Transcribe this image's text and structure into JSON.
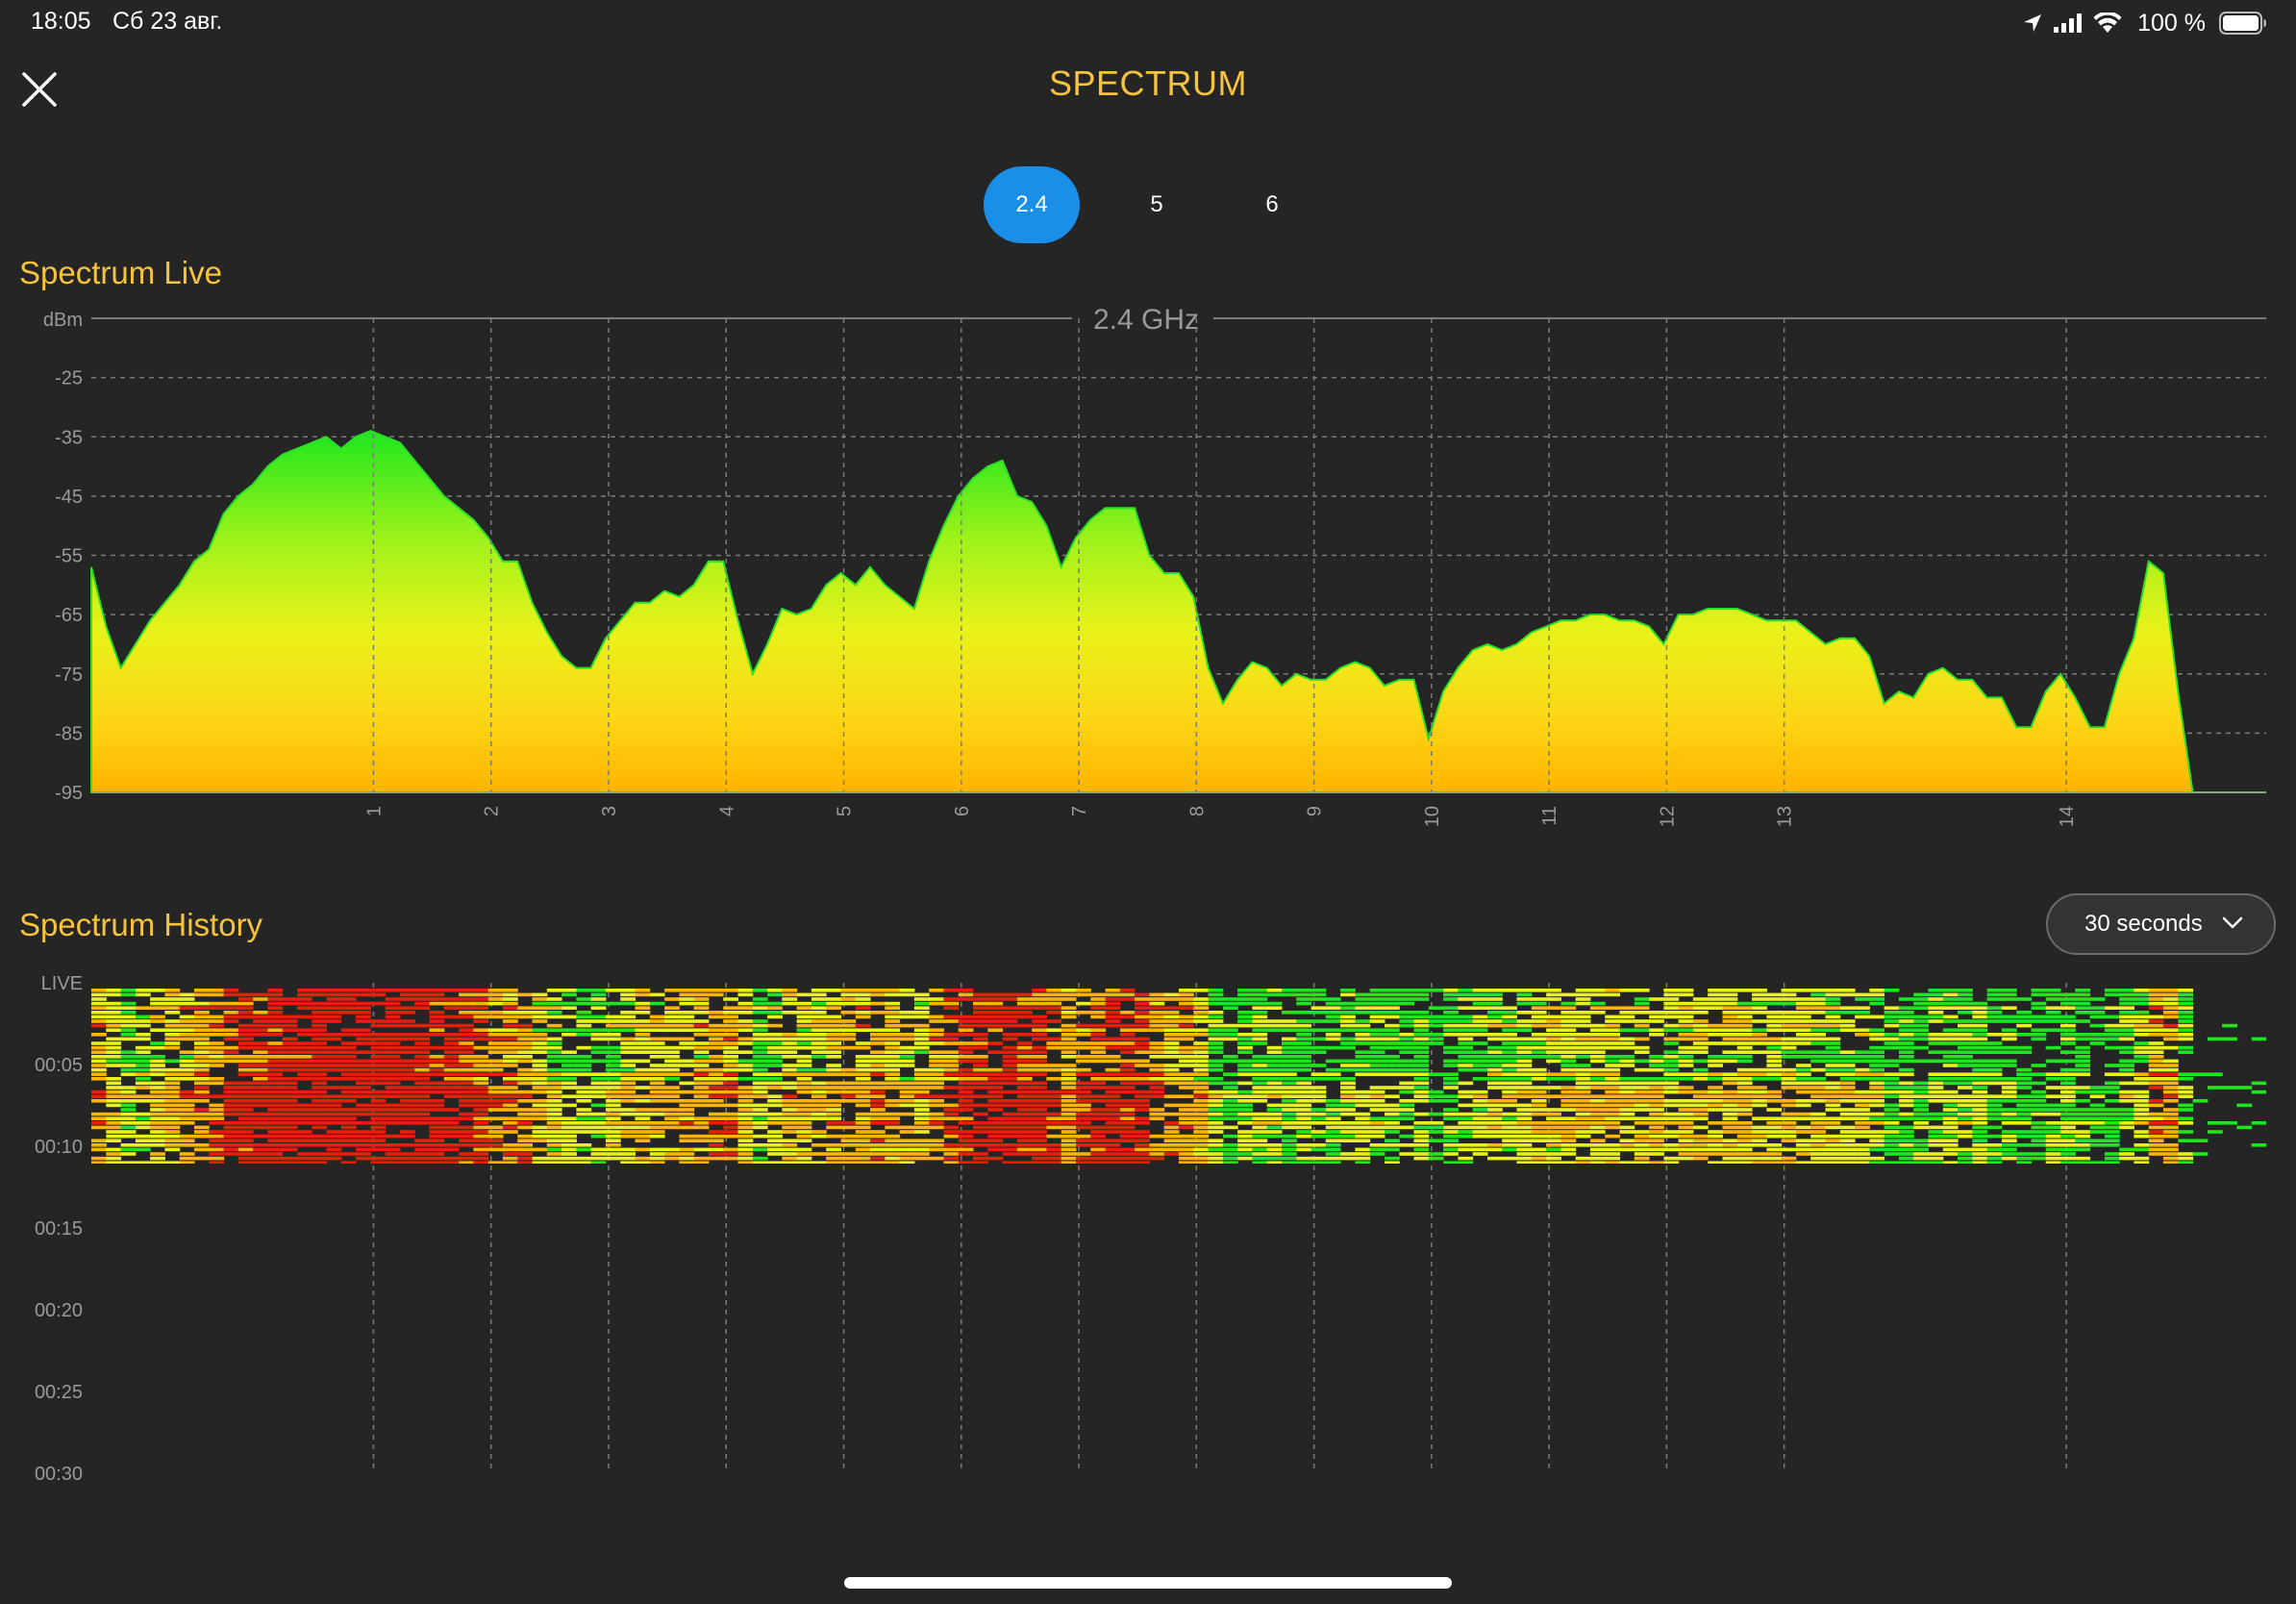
{
  "status_bar": {
    "time": "18:05",
    "date": "Сб 23 авг.",
    "battery": "100 %"
  },
  "header": {
    "title": "SPECTRUM",
    "close_icon": "close-icon"
  },
  "band_tabs": [
    {
      "label": "2.4",
      "active": true
    },
    {
      "label": "5",
      "active": false
    },
    {
      "label": "6",
      "active": false
    }
  ],
  "live": {
    "title": "Spectrum Live",
    "band_label": "2.4 GHz"
  },
  "history": {
    "title": "Spectrum History",
    "range_selected": "30 seconds"
  },
  "colors": {
    "accent": "#f7c33c",
    "active_tab": "#1a8fe8",
    "background": "#252525",
    "grid": "#7a7a7a",
    "signal_green": "#1ee61e",
    "signal_yellow": "#e8f21a",
    "signal_orange": "#ffb400",
    "signal_red": "#e81e0a"
  },
  "chart_data": [
    {
      "type": "area",
      "ylabel": "dBm",
      "ylim": [
        -95,
        -15
      ],
      "y_ticks": [
        -25,
        -35,
        -45,
        -55,
        -65,
        -75,
        -85,
        -95
      ],
      "x_ticks": [
        "1",
        "2",
        "3",
        "4",
        "5",
        "6",
        "7",
        "8",
        "9",
        "10",
        "11",
        "12",
        "13",
        "14"
      ],
      "grid": true,
      "x": [
        0,
        0.25,
        0.5,
        0.75,
        1,
        1.25,
        1.5,
        1.75,
        2,
        2.25,
        2.5,
        2.75,
        3,
        3.25,
        3.5,
        3.75,
        4,
        4.25,
        4.5,
        4.75,
        5,
        5.25,
        5.5,
        5.75,
        6,
        6.25,
        6.5,
        6.75,
        7,
        7.25,
        7.5,
        7.75,
        8,
        8.25,
        8.5,
        8.75,
        9,
        9.25,
        9.5,
        9.75,
        10,
        10.25,
        10.5,
        10.75,
        11,
        11.25,
        11.5,
        11.75,
        12,
        12.25,
        12.5,
        12.75,
        13,
        13.25,
        13.5,
        13.75,
        14,
        14.25,
        14.5,
        14.75,
        15,
        15.25,
        15.5,
        15.75,
        16,
        16.25,
        16.5,
        16.75,
        17,
        17.25,
        17.5,
        17.75,
        18,
        18.25,
        18.5,
        18.75,
        19,
        19.25,
        19.5,
        19.75,
        20,
        20.25,
        20.5,
        20.75,
        21,
        21.25,
        21.5,
        21.75,
        22,
        22.25,
        22.5,
        22.75,
        23,
        23.25,
        23.5,
        23.75,
        24,
        24.25,
        24.5,
        24.75,
        25,
        25.25,
        25.5,
        25.75,
        26,
        26.25,
        26.5,
        26.75,
        27,
        27.25,
        27.5,
        27.75,
        28,
        28.25,
        28.5,
        28.75,
        29,
        29.25,
        29.5,
        29.75,
        30,
        30.25,
        30.5,
        30.75,
        31,
        31.25,
        31.5,
        31.75,
        32,
        32.25,
        32.5,
        32.75,
        33,
        33.25,
        33.5,
        33.75,
        34,
        34.25,
        34.5,
        34.75,
        35,
        35.25,
        35.5,
        35.75,
        36,
        36.25,
        36.5,
        36.75,
        37
      ],
      "series": [
        {
          "values": [
            -57,
            -67,
            -74,
            -70,
            -66,
            -63,
            -60,
            -56,
            -54,
            -48,
            -45,
            -43,
            -40,
            -38,
            -37,
            -36,
            -35,
            -37,
            -35,
            -34,
            -35,
            -36,
            -39,
            -42,
            -45,
            -47,
            -49,
            -52,
            -56,
            -56,
            -63,
            -68,
            -72,
            -74,
            -74,
            -69,
            -66,
            -63,
            -63,
            -61,
            -62,
            -60,
            -56,
            -56,
            -66,
            -75,
            -70,
            -64,
            -65,
            -64,
            -60,
            -58,
            -60,
            -57,
            -60,
            -62,
            -64,
            -56,
            -50,
            -45,
            -42,
            -40,
            -39,
            -45,
            -46,
            -50,
            -57,
            -52,
            -49,
            -47,
            -47,
            -47,
            -55,
            -58,
            -58,
            -62,
            -74,
            -80,
            -76,
            -73,
            -74,
            -77,
            -75,
            -76,
            -76,
            -74,
            -73,
            -74,
            -77,
            -76,
            -76,
            -86,
            -78,
            -74,
            -71,
            -70,
            -71,
            -70,
            -68,
            -67,
            -66,
            -66,
            -65,
            -65,
            -66,
            -66,
            -67,
            -70,
            -65,
            -65,
            -64,
            -64,
            -64,
            -65,
            -66,
            -66,
            -66,
            -68,
            -70,
            -69,
            -69,
            -72,
            -80,
            -78,
            -79,
            -75,
            -74,
            -76,
            -76,
            -79,
            -79,
            -84,
            -84,
            -78,
            -75,
            -79,
            -84,
            -84,
            -75,
            -69,
            -56,
            -58,
            -78,
            -95,
            -95,
            -95,
            -95,
            -95,
            -95
          ]
        }
      ]
    },
    {
      "type": "heatmap",
      "ylabel": "",
      "y_ticks": [
        "LIVE",
        "00:05",
        "00:10",
        "00:15",
        "00:20",
        "00:25",
        "00:30"
      ],
      "x_ticks": [
        "1",
        "2",
        "3",
        "4",
        "5",
        "6",
        "7",
        "8",
        "9",
        "10",
        "11",
        "12",
        "13",
        "14"
      ],
      "grid": true,
      "rows_recorded_seconds": 11
    }
  ]
}
